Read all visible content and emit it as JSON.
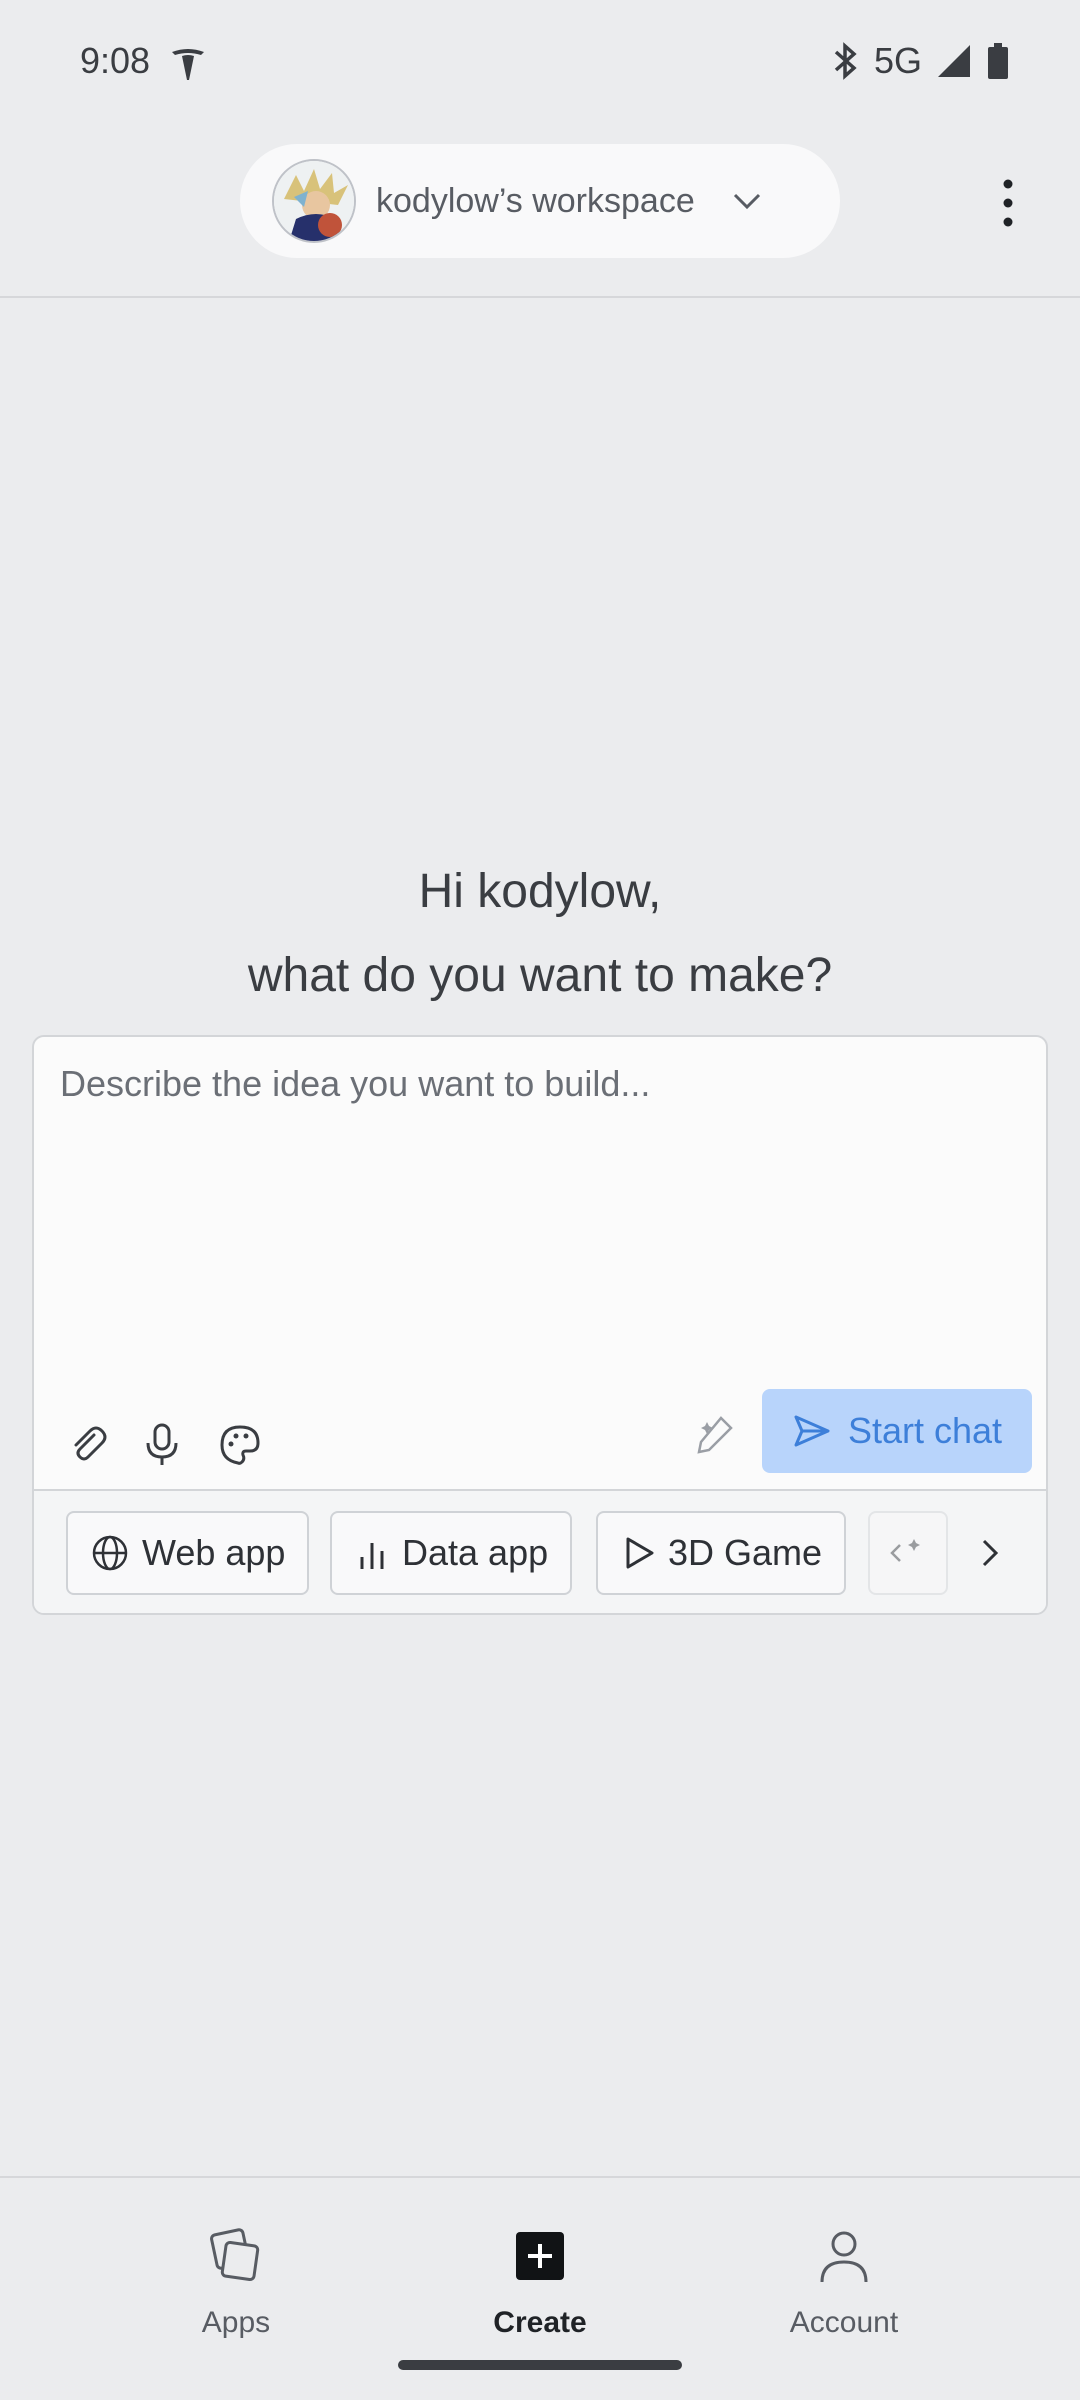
{
  "status_bar": {
    "time": "9:08",
    "network": "5G",
    "icons": [
      "tesla-icon",
      "bluetooth-icon",
      "signal-icon",
      "battery-icon"
    ]
  },
  "header": {
    "workspace_name": "kodylow’s workspace",
    "icons": [
      "avatar",
      "chevron-down-icon",
      "more-vert-icon"
    ]
  },
  "greeting": {
    "line1": "Hi kodylow,",
    "line2": "what do you want to make?"
  },
  "prompt": {
    "placeholder": "Describe the idea you want to build...",
    "value": "",
    "start_chat_label": "Start chat",
    "tools": [
      "attach-icon",
      "mic-icon",
      "palette-icon",
      "magic-pen-icon"
    ]
  },
  "chips": [
    {
      "label": "Web app",
      "icon": "globe-icon"
    },
    {
      "label": "Data app",
      "icon": "bar-chart-icon"
    },
    {
      "label": "3D Game",
      "icon": "play-icon"
    }
  ],
  "nav": {
    "items": [
      {
        "label": "Apps",
        "icon": "apps-icon"
      },
      {
        "label": "Create",
        "icon": "create-icon",
        "active": true
      },
      {
        "label": "Account",
        "icon": "account-icon"
      }
    ]
  },
  "colors": {
    "background": "#ebecee",
    "accent": "#3d7fd9",
    "accent_bg": "#b8d4fb"
  }
}
